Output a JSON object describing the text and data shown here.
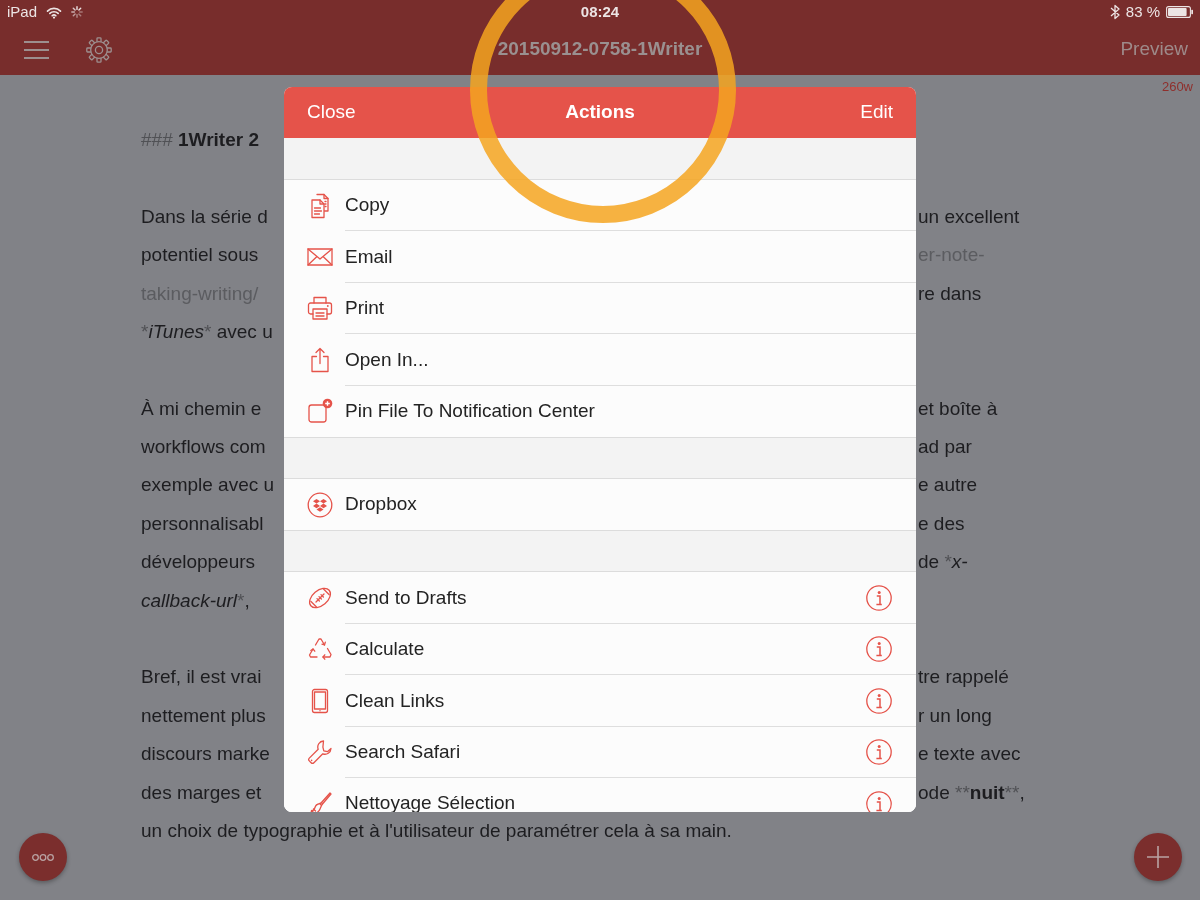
{
  "status_bar": {
    "device": "iPad",
    "time": "08:24",
    "battery": "83 %"
  },
  "nav_bar": {
    "title": "20150912-0758-1Writer",
    "preview": "Preview"
  },
  "word_count": "260w",
  "editor": {
    "paragraphs": [
      {
        "lines": [
          {
            "left": [
              {
                "kind": "syntax",
                "text": "### "
              },
              {
                "kind": "bold",
                "text": "1Writer 2"
              }
            ]
          }
        ]
      },
      {
        "lines": [
          {
            "left": [
              {
                "kind": "text",
                "text": "Dans la série d"
              }
            ],
            "right": [
              {
                "kind": "text",
                "text": "un excellent"
              }
            ]
          },
          {
            "left": [
              {
                "kind": "text",
                "text": "potentiel sous"
              }
            ],
            "right": [
              {
                "kind": "link",
                "text": "er-note-"
              }
            ]
          },
          {
            "left": [
              {
                "kind": "link",
                "text": "taking-writing/"
              }
            ],
            "right": [
              {
                "kind": "text",
                "text": "re dans"
              }
            ]
          },
          {
            "left": [
              {
                "kind": "syntax",
                "text": "*"
              },
              {
                "kind": "italic",
                "text": "iTunes"
              },
              {
                "kind": "syntax",
                "text": "*"
              },
              {
                "kind": "text",
                "text": " avec u"
              }
            ]
          }
        ]
      },
      {
        "lines": [
          {
            "left": [
              {
                "kind": "text",
                "text": "À mi chemin e"
              }
            ],
            "right": [
              {
                "kind": "text",
                "text": "et boîte à"
              }
            ]
          },
          {
            "left": [
              {
                "kind": "text",
                "text": "workflows com"
              }
            ],
            "right": [
              {
                "kind": "text",
                "text": "ad par"
              }
            ]
          },
          {
            "left": [
              {
                "kind": "text",
                "text": "exemple avec u"
              }
            ],
            "right": [
              {
                "kind": "text",
                "text": "e autre"
              }
            ]
          },
          {
            "left": [
              {
                "kind": "text",
                "text": "personnalisabl"
              }
            ],
            "right": [
              {
                "kind": "text",
                "text": "e des"
              }
            ]
          },
          {
            "left": [
              {
                "kind": "text",
                "text": "développeurs"
              }
            ],
            "right": [
              {
                "kind": "text",
                "text": "de "
              },
              {
                "kind": "syntax",
                "text": "*"
              },
              {
                "kind": "italic",
                "text": "x-"
              }
            ]
          },
          {
            "left": [
              {
                "kind": "italic",
                "text": "callback-url"
              },
              {
                "kind": "syntax",
                "text": "*"
              },
              {
                "kind": "text",
                "text": ","
              }
            ]
          }
        ]
      },
      {
        "lines": [
          {
            "left": [
              {
                "kind": "text",
                "text": "Bref, il est vrai"
              }
            ],
            "right": [
              {
                "kind": "text",
                "text": "tre rappelé"
              }
            ]
          },
          {
            "left": [
              {
                "kind": "text",
                "text": "nettement plus"
              }
            ],
            "right": [
              {
                "kind": "text",
                "text": "r un long"
              }
            ]
          },
          {
            "left": [
              {
                "kind": "text",
                "text": "discours marke"
              }
            ],
            "right": [
              {
                "kind": "text",
                "text": "e texte avec"
              }
            ]
          },
          {
            "left": [
              {
                "kind": "text",
                "text": "des marges et"
              }
            ],
            "right": [
              {
                "kind": "text",
                "text": "ode "
              },
              {
                "kind": "syntax",
                "text": "**"
              },
              {
                "kind": "bold",
                "text": "nuit"
              },
              {
                "kind": "syntax",
                "text": "**"
              },
              {
                "kind": "text",
                "text": ","
              }
            ]
          },
          {
            "left": [
              {
                "kind": "text",
                "text": "un choix de typographie et à l'utilisateur de paramétrer cela à sa main."
              }
            ]
          }
        ]
      }
    ]
  },
  "actions_sheet": {
    "close": "Close",
    "title": "Actions",
    "edit": "Edit",
    "sections": [
      {
        "items": [
          {
            "label": "Copy",
            "info": false
          },
          {
            "label": "Email",
            "info": false
          },
          {
            "label": "Print",
            "info": false
          },
          {
            "label": "Open In...",
            "info": false
          },
          {
            "label": "Pin File To Notification Center",
            "info": false
          }
        ]
      },
      {
        "items": [
          {
            "label": "Dropbox",
            "info": false
          }
        ]
      },
      {
        "items": [
          {
            "label": "Send to Drafts",
            "info": true
          },
          {
            "label": "Calculate",
            "info": true
          },
          {
            "label": "Clean Links",
            "info": true
          },
          {
            "label": "Search Safari",
            "info": true
          },
          {
            "label": "Nettoyage Sélection",
            "info": true
          }
        ]
      }
    ]
  }
}
